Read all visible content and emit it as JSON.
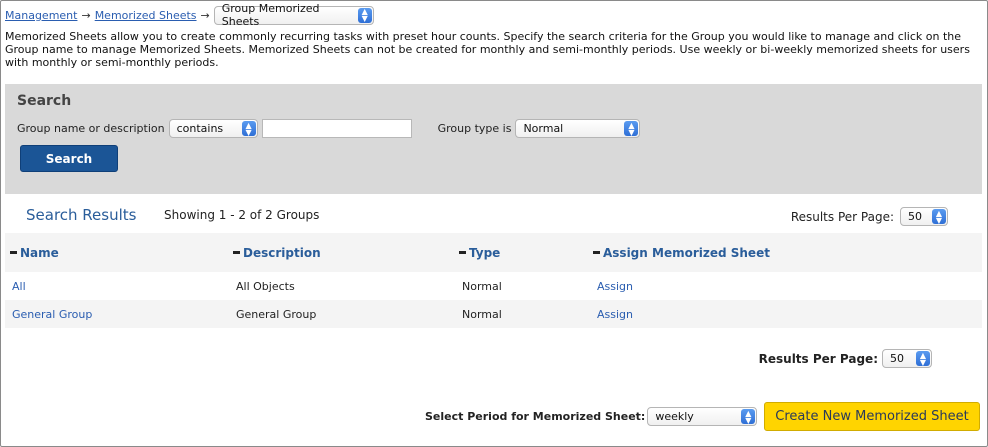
{
  "breadcrumb": {
    "items": [
      "Management",
      "Memorized Sheets"
    ],
    "arrow": "→",
    "current_select": "Group Memorized Sheets"
  },
  "intro_text": "Memorized Sheets allow you to create commonly recurring tasks with preset hour counts. Specify the search criteria for the Group you would like to manage and click on the Group name to manage Memorized Sheets. Memorized Sheets can not be created for monthly and semi-monthly periods. Use weekly or bi-weekly memorized sheets for users with monthly or semi-monthly periods.",
  "search": {
    "heading": "Search",
    "group_label": "Group name or description",
    "match_select": "contains",
    "query_value": "",
    "group_type_label": "Group type is",
    "group_type_select": "Normal",
    "button": "Search"
  },
  "results": {
    "title": "Search Results",
    "showing": "Showing 1 - 2 of 2 Groups",
    "rpp_label": "Results Per Page:",
    "rpp_value": "50",
    "columns": [
      "Name",
      "Description",
      "Type",
      "Assign Memorized Sheet"
    ],
    "rows": [
      {
        "name": "All",
        "description": "All Objects",
        "type": "Normal",
        "action": "Assign"
      },
      {
        "name": "General Group",
        "description": "General Group",
        "type": "Normal",
        "action": "Assign"
      }
    ]
  },
  "footer": {
    "rpp_label": "Results Per Page:",
    "rpp_value": "50",
    "period_label": "Select Period for Memorized Sheet:",
    "period_value": "weekly",
    "create_button": "Create New Memorized Sheet"
  },
  "colors": {
    "accent": "#1b5596",
    "link": "#2a5db0",
    "panel": "#d9d9d9",
    "create_button": "#ffd400"
  }
}
